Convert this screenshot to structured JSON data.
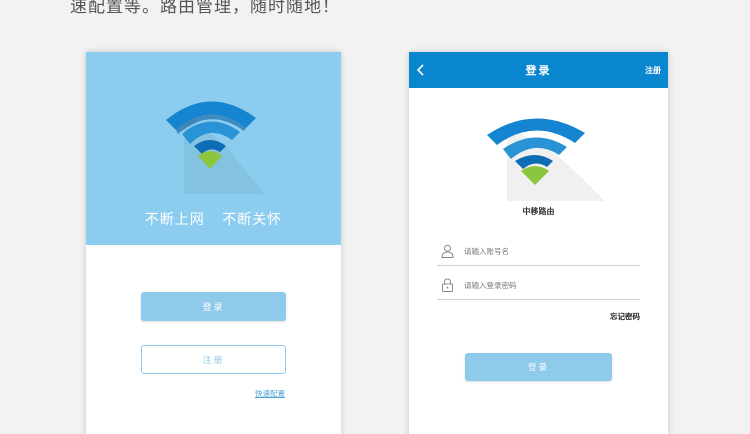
{
  "page_caption": "速配置等。路由管理，随时随地！",
  "left_screen": {
    "slogan": [
      "不断上网",
      "不断关怀"
    ],
    "login_button": "登录",
    "register_button": "注册",
    "quick_config_link": "快速配置"
  },
  "right_screen": {
    "title": "登录",
    "register_link": "注册",
    "brand_name": "中移路由",
    "username": {
      "placeholder": "请输入账号名",
      "value": ""
    },
    "password": {
      "placeholder": "请输入登录密码",
      "value": ""
    },
    "forgot_password_link": "忘记密码",
    "login_button": "登录"
  },
  "colors": {
    "hero_background": "#8ccdef",
    "title_bar": "#0a86cf",
    "button": "#8ecaea",
    "wifi_dark": "#0a6fb8",
    "wifi_mid": "#1f8ad3",
    "wifi_dot": "#8cc63f"
  }
}
